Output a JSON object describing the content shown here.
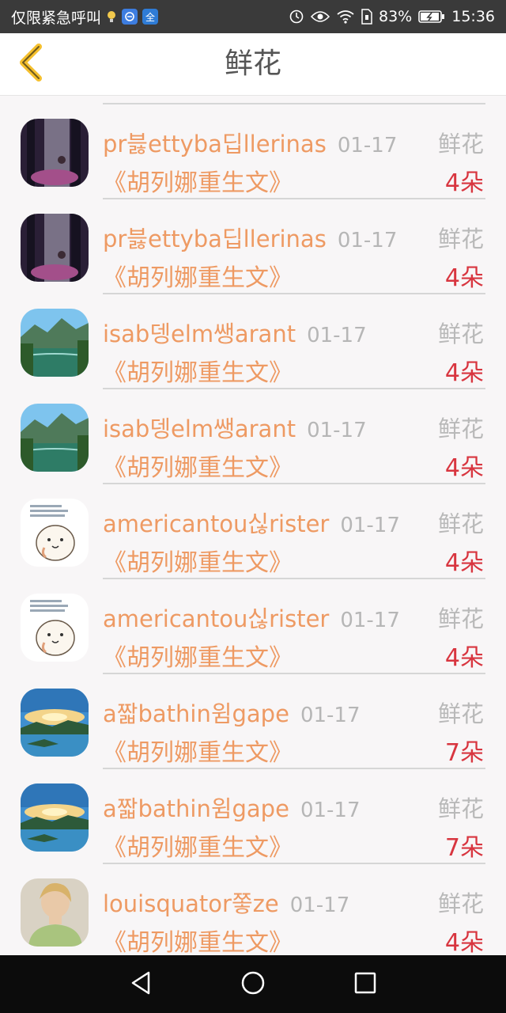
{
  "status_bar": {
    "carrier_text": "仅限紧急呼叫",
    "battery_percent": "83%",
    "time": "15:36",
    "icons": [
      "bulb-icon",
      "app-browser-icon",
      "app-quan-icon",
      "alarm-icon",
      "eye-icon",
      "wifi-icon",
      "sim-icon",
      "battery-icon"
    ],
    "quan_label": "全"
  },
  "header": {
    "title": "鲜花",
    "back_icon": "chevron-left-icon",
    "accent_color": "#f5c02e"
  },
  "list": {
    "items": [
      {
        "name": "pr븛ettyba딥llerinas",
        "date": "01-17",
        "gift": "鲜花",
        "book": "《胡列娜重生文》",
        "qty": "4朵",
        "avatar": "forest-dusk"
      },
      {
        "name": "pr븛ettyba딥llerinas",
        "date": "01-17",
        "gift": "鲜花",
        "book": "《胡列娜重生文》",
        "qty": "4朵",
        "avatar": "forest-dusk"
      },
      {
        "name": "isab뎅elm쌩arant",
        "date": "01-17",
        "gift": "鲜花",
        "book": "《胡列娜重生文》",
        "qty": "4朵",
        "avatar": "lake-mountain"
      },
      {
        "name": "isab뎅elm쌩arant",
        "date": "01-17",
        "gift": "鲜花",
        "book": "《胡列娜重生文》",
        "qty": "4朵",
        "avatar": "lake-mountain"
      },
      {
        "name": "americantou싢rister",
        "date": "01-17",
        "gift": "鲜花",
        "book": "《胡列娜重生文》",
        "qty": "4朵",
        "avatar": "cartoon-bun"
      },
      {
        "name": "americantou싢rister",
        "date": "01-17",
        "gift": "鲜花",
        "book": "《胡列娜重生文》",
        "qty": "4朵",
        "avatar": "cartoon-bun"
      },
      {
        "name": "a짧bathin윔gape",
        "date": "01-17",
        "gift": "鲜花",
        "book": "《胡列娜重生文》",
        "qty": "7朵",
        "avatar": "sunset-islands"
      },
      {
        "name": "a짧bathin윔gape",
        "date": "01-17",
        "gift": "鲜花",
        "book": "《胡列娜重生文》",
        "qty": "7朵",
        "avatar": "sunset-islands"
      },
      {
        "name": "louisquator쫗ze",
        "date": "01-17",
        "gift": "鲜花",
        "book": "《胡列娜重生文》",
        "qty": "4朵",
        "avatar": "woman-portrait"
      }
    ]
  },
  "nav_bar": {
    "buttons": [
      "back-triangle-icon",
      "home-circle-icon",
      "recents-square-icon"
    ]
  },
  "colors": {
    "name_orange": "#ee9a63",
    "qty_red": "#d8353f",
    "muted_gray": "#b6b6b6"
  }
}
